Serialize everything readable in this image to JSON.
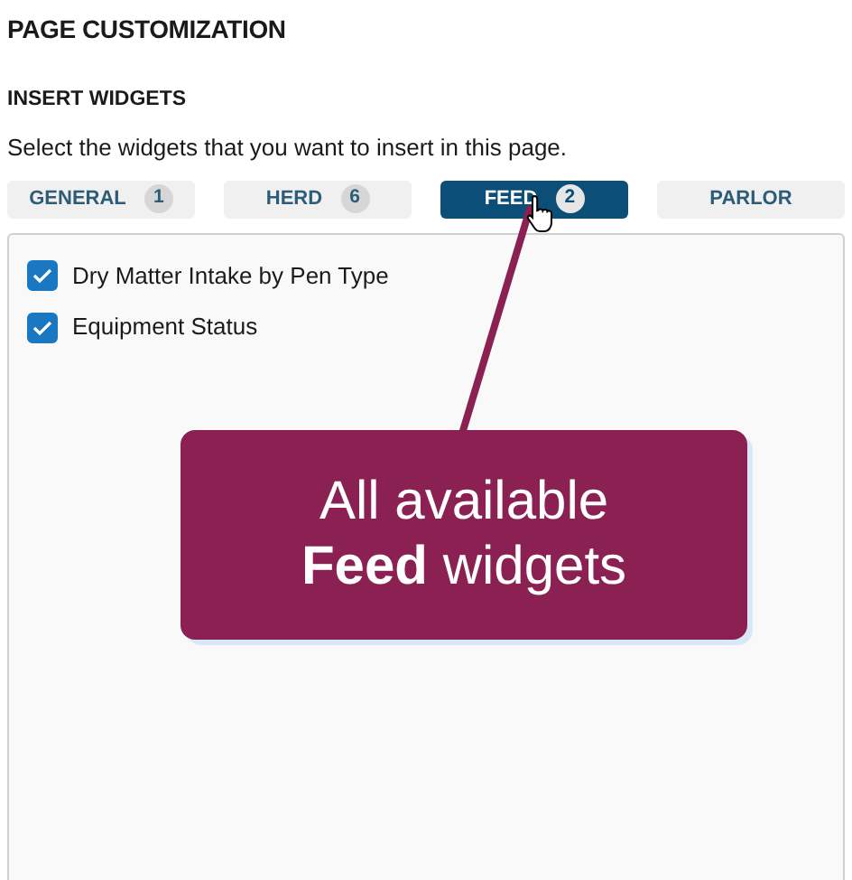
{
  "title": "PAGE CUSTOMIZATION",
  "section": {
    "title": "INSERT WIDGETS",
    "description": "Select the widgets that you want to insert in this page."
  },
  "tabs": [
    {
      "label": "GENERAL",
      "count": "1",
      "selected": false
    },
    {
      "label": "HERD",
      "count": "6",
      "selected": false
    },
    {
      "label": "FEED",
      "count": "2",
      "selected": true
    },
    {
      "label": "PARLOR",
      "selected": false
    }
  ],
  "widgets": [
    {
      "label": "Dry Matter Intake by Pen Type",
      "checked": true
    },
    {
      "label": "Equipment Status",
      "checked": true
    }
  ],
  "callout": {
    "text": "All available **Feed** widgets"
  }
}
